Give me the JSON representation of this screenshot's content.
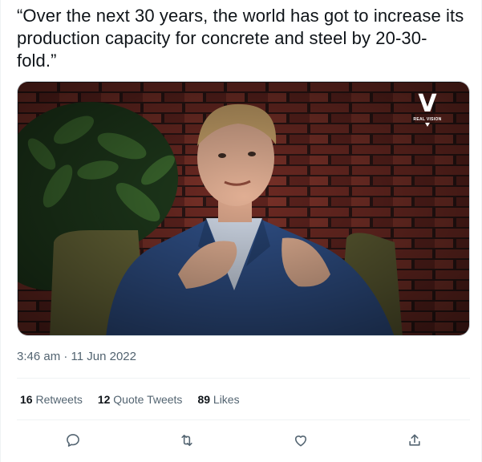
{
  "tweet": {
    "text": "“Over the next 30 years, the world has got to increase its production capacity for concrete and steel by 20-30-fold.”",
    "timestamp": "3:46 am · 11 Jun 2022"
  },
  "media": {
    "watermark_logo": "V",
    "watermark_text": "REAL VISION"
  },
  "stats": {
    "retweets_count": "16",
    "retweets_label": "Retweets",
    "quote_count": "12",
    "quote_label": "Quote Tweets",
    "likes_count": "89",
    "likes_label": "Likes"
  },
  "actions": {
    "reply_icon": "reply-icon",
    "retweet_icon": "retweet-icon",
    "like_icon": "like-icon",
    "share_icon": "share-icon"
  },
  "colors": {
    "text": "#0f1419",
    "secondary": "#536471",
    "divider": "#eff3f4",
    "icon": "#536471"
  }
}
